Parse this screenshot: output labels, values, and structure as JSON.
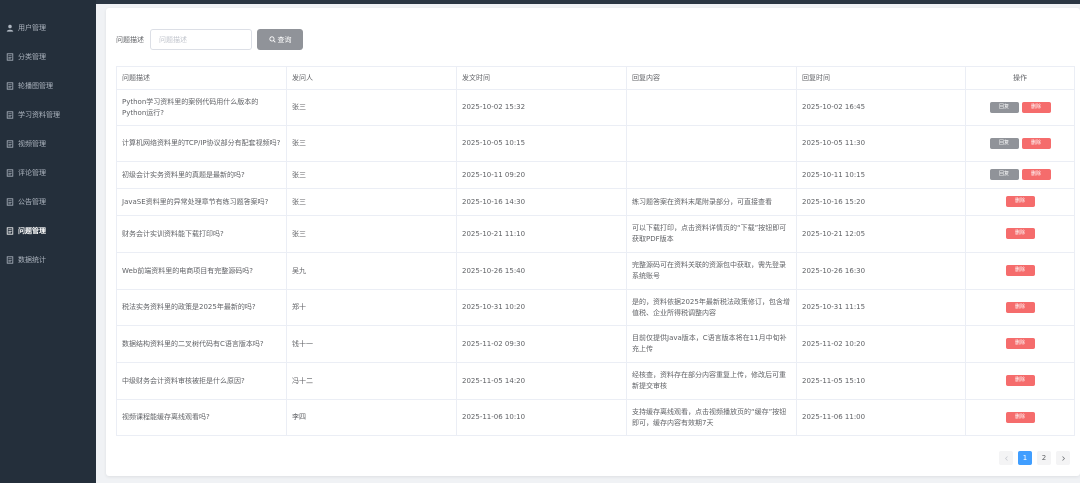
{
  "sidebar": {
    "items": [
      {
        "label": "用户管理",
        "icon": "user-icon",
        "active": false
      },
      {
        "label": "分类管理",
        "icon": "document-icon",
        "active": false
      },
      {
        "label": "轮播图管理",
        "icon": "document-icon",
        "active": false
      },
      {
        "label": "学习资料管理",
        "icon": "document-icon",
        "active": false
      },
      {
        "label": "视频管理",
        "icon": "document-icon",
        "active": false
      },
      {
        "label": "评论管理",
        "icon": "document-icon",
        "active": false
      },
      {
        "label": "公告管理",
        "icon": "document-icon",
        "active": false
      },
      {
        "label": "问题管理",
        "icon": "document-icon",
        "active": true
      },
      {
        "label": "数据统计",
        "icon": "document-icon",
        "active": false
      }
    ]
  },
  "search": {
    "label": "问题描述",
    "placeholder": "问题描述",
    "value": "",
    "button_label": "查询"
  },
  "table": {
    "headers": {
      "question": "问题描述",
      "asker": "发问人",
      "ask_time": "发文时间",
      "reply": "回复内容",
      "reply_time": "回复时间",
      "ops": "操作"
    },
    "reply_label": "回复",
    "delete_label": "删除",
    "rows": [
      {
        "question": "Python学习资料里的案例代码用什么版本的Python运行?",
        "asker": "张三",
        "ask_time": "2025-10-02 15:32",
        "reply": "",
        "reply_time": "2025-10-02 16:45",
        "has_reply_btn": true
      },
      {
        "question": "计算机网络资料里的TCP/IP协议部分有配套视频吗?",
        "asker": "张三",
        "ask_time": "2025-10-05 10:15",
        "reply": "",
        "reply_time": "2025-10-05 11:30",
        "has_reply_btn": true
      },
      {
        "question": "初级会计实务资料里的真题是最新的吗?",
        "asker": "张三",
        "ask_time": "2025-10-11 09:20",
        "reply": "",
        "reply_time": "2025-10-11 10:15",
        "has_reply_btn": true
      },
      {
        "question": "JavaSE资料里的异常处理章节有练习题答案吗?",
        "asker": "张三",
        "ask_time": "2025-10-16 14:30",
        "reply": "练习题答案在资料末尾附录部分，可直接查看",
        "reply_time": "2025-10-16 15:20",
        "has_reply_btn": false
      },
      {
        "question": "财务会计实训资料能下载打印吗?",
        "asker": "张三",
        "ask_time": "2025-10-21 11:10",
        "reply": "可以下载打印，点击资料详情页的“下载”按钮即可获取PDF版本",
        "reply_time": "2025-10-21 12:05",
        "has_reply_btn": false
      },
      {
        "question": "Web前端资料里的电商项目有完整源码吗?",
        "asker": "吴九",
        "ask_time": "2025-10-26 15:40",
        "reply": "完整源码可在资料关联的资源包中获取，需先登录系统账号",
        "reply_time": "2025-10-26 16:30",
        "has_reply_btn": false
      },
      {
        "question": "税法实务资料里的政策是2025年最新的吗?",
        "asker": "郑十",
        "ask_time": "2025-10-31 10:20",
        "reply": "是的，资料依据2025年最新税法政策修订，包含增值税、企业所得税调整内容",
        "reply_time": "2025-10-31 11:15",
        "has_reply_btn": false
      },
      {
        "question": "数据结构资料里的二叉树代码有C语言版本吗?",
        "asker": "钱十一",
        "ask_time": "2025-11-02 09:30",
        "reply": "目前仅提供Java版本，C语言版本将在11月中旬补充上传",
        "reply_time": "2025-11-02 10:20",
        "has_reply_btn": false
      },
      {
        "question": "中级财务会计资料审核被拒是什么原因?",
        "asker": "冯十二",
        "ask_time": "2025-11-05 14:20",
        "reply": "经核查，资料存在部分内容重复上传，修改后可重新提交审核",
        "reply_time": "2025-11-05 15:10",
        "has_reply_btn": false
      },
      {
        "question": "视频课程能缓存离线观看吗?",
        "asker": "李四",
        "ask_time": "2025-11-06 10:10",
        "reply": "支持缓存离线观看，点击视频播放页的“缓存”按钮即可，缓存内容有效期7天",
        "reply_time": "2025-11-06 11:00",
        "has_reply_btn": false
      }
    ]
  },
  "pagination": {
    "pages": [
      "1",
      "2"
    ],
    "current": "1"
  },
  "colors": {
    "sidebar_bg": "#242f3b",
    "primary": "#409eff",
    "danger": "#f56c6c",
    "info": "#909399"
  }
}
